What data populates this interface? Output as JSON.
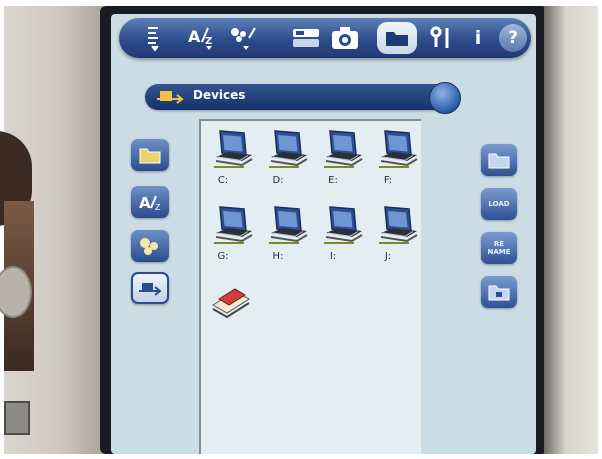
{
  "toolbar": {
    "items": [
      {
        "name": "list-sort-icon",
        "glyph": "⇞"
      },
      {
        "name": "az-sort-icon",
        "glyph": "A/"
      },
      {
        "name": "flowers-icon",
        "glyph": "✿"
      },
      {
        "name": "toggle-icon",
        "glyph": "▭"
      },
      {
        "name": "camera-icon",
        "glyph": "◙"
      },
      {
        "name": "folder-icon",
        "glyph": ""
      },
      {
        "name": "settings-icon",
        "glyph": "8|"
      },
      {
        "name": "info-icon",
        "glyph": "i"
      },
      {
        "name": "help-icon",
        "glyph": "?"
      }
    ],
    "active": "folder-icon"
  },
  "location": {
    "label": "Devices"
  },
  "drives": [
    "C:",
    "D:",
    "E:",
    "F:",
    "G:",
    "H:",
    "I:",
    "J:"
  ],
  "right_buttons": {
    "load": "LOAD",
    "rename_line1": "RE",
    "rename_line2": "NAME"
  },
  "colors": {
    "accent": "#2c4c8c",
    "screen_bg": "#ccdce4",
    "pane_bg": "#e3eef3"
  }
}
